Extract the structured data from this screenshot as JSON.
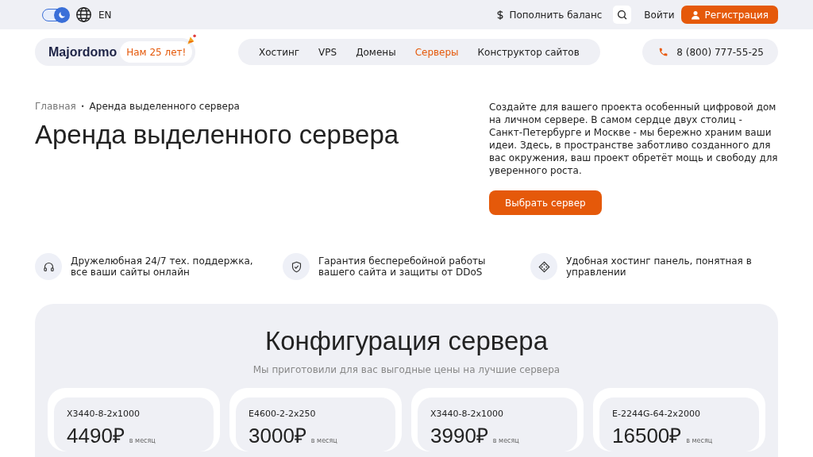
{
  "topbar": {
    "theme_toggle": {
      "on": true
    },
    "language": "EN",
    "balance_link": "Пополнить баланс",
    "login": "Войти",
    "register": "Регистрация"
  },
  "header": {
    "logo": "Majordomo",
    "badge": "Нам 25 лет!",
    "nav": [
      {
        "label": "Хостинг",
        "selected": false
      },
      {
        "label": "VPS",
        "selected": false
      },
      {
        "label": "Домены",
        "selected": false
      },
      {
        "label": "Серверы",
        "selected": true
      },
      {
        "label": "Конструктор сайтов",
        "selected": false
      }
    ],
    "phone": "8 (800) 777-55-25"
  },
  "breadcrumbs": [
    "Главная",
    "Аренда выделенного сервера"
  ],
  "breadcrumb_separator": "•",
  "title": "Аренда выделенного сервера",
  "intro": "Создайте для вашего проекта особенный цифровой дом на личном сервере. В самом сердце двух столиц - Санкт-Петербурге и Москве - мы бережно храним ваши идеи. Здесь, в пространстве заботливо созданного для вас окружения, ваш проект обретёт мощь и свободу для уверенного роста.",
  "cta": "Выбрать сервер",
  "features": [
    {
      "kind": "headphones",
      "text": "Дружелюбная 24/7 тех. поддержка, все ваши сайты онлайн"
    },
    {
      "kind": "shield",
      "text": "Гарантия бесперебойной работы вашего сайта и защиты от DDoS"
    },
    {
      "kind": "panel",
      "text": "Удобная хостинг панель, понятная в управлении"
    }
  ],
  "config": {
    "title": "Конфигурация сервера",
    "subtitle": "Мы приготовили для вас выгодные цены на лучшие сервера",
    "servers": [
      {
        "name": "X3440-8-2x1000",
        "price": "4490₽",
        "period": "в месяц"
      },
      {
        "name": "E4600-2-2x250",
        "price": "3000₽",
        "period": "в месяц"
      },
      {
        "name": "X3440-8-2x1000",
        "price": "3990₽",
        "period": "в месяц"
      },
      {
        "name": "E-2244G-64-2x2000",
        "price": "16500₽",
        "period": "в месяц"
      }
    ]
  }
}
